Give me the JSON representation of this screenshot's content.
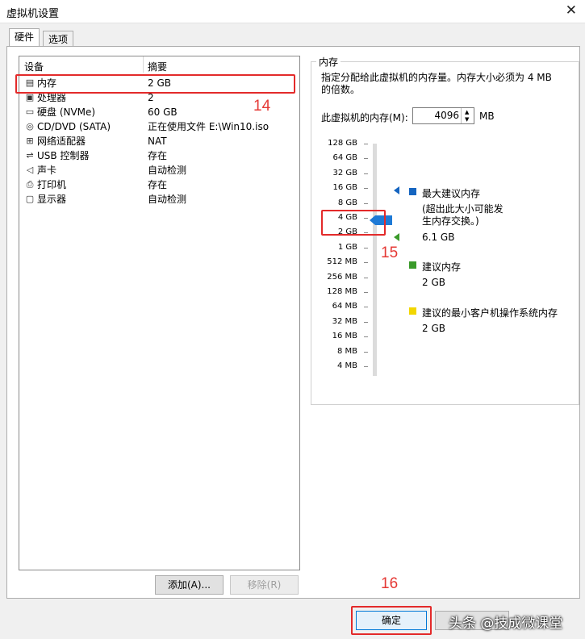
{
  "window": {
    "title": "虚拟机设置"
  },
  "tabs": [
    "硬件",
    "选项"
  ],
  "device_list": {
    "headers": {
      "device": "设备",
      "summary": "摘要"
    },
    "rows": [
      {
        "name": "内存",
        "summary": "2 GB",
        "icon": "memory-icon"
      },
      {
        "name": "处理器",
        "summary": "2",
        "icon": "cpu-icon"
      },
      {
        "name": "硬盘 (NVMe)",
        "summary": "60 GB",
        "icon": "disk-icon"
      },
      {
        "name": "CD/DVD (SATA)",
        "summary": "正在使用文件 E:\\Win10.iso",
        "icon": "cd-icon"
      },
      {
        "name": "网络适配器",
        "summary": "NAT",
        "icon": "network-icon"
      },
      {
        "name": "USB 控制器",
        "summary": "存在",
        "icon": "usb-icon"
      },
      {
        "name": "声卡",
        "summary": "自动检测",
        "icon": "speaker-icon"
      },
      {
        "name": "打印机",
        "summary": "存在",
        "icon": "printer-icon"
      },
      {
        "name": "显示器",
        "summary": "自动检测",
        "icon": "monitor-icon"
      }
    ]
  },
  "buttons": {
    "add": "添加(A)...",
    "remove": "移除(R)",
    "ok": "确定"
  },
  "memory": {
    "group_title": "内存",
    "description": "指定分配给此虚拟机的内存量。内存大小必须为 4 MB 的倍数。",
    "field_label": "此虚拟机的内存(M):",
    "value": "4096",
    "unit": "MB",
    "scale_labels": [
      "128 GB",
      "64 GB",
      "32 GB",
      "16 GB",
      "8 GB",
      "4 GB",
      "2 GB",
      "1 GB",
      "512 MB",
      "256 MB",
      "128 MB",
      "64 MB",
      "32 MB",
      "16 MB",
      "8 MB",
      "4 MB"
    ],
    "legend": {
      "max_title": "最大建议内存",
      "max_note": "(超出此大小可能发生内存交换。)",
      "max_value": "6.1 GB",
      "rec_title": "建议内存",
      "rec_value": "2 GB",
      "min_title": "建议的最小客户机操作系统内存",
      "min_value": "2 GB"
    },
    "colors": {
      "max": "#1565c0",
      "recommended": "#3a9a2a",
      "minimum": "#f2d600"
    }
  },
  "annotations": [
    "14",
    "15",
    "16"
  ],
  "watermark": "头条 @技成微课堂"
}
